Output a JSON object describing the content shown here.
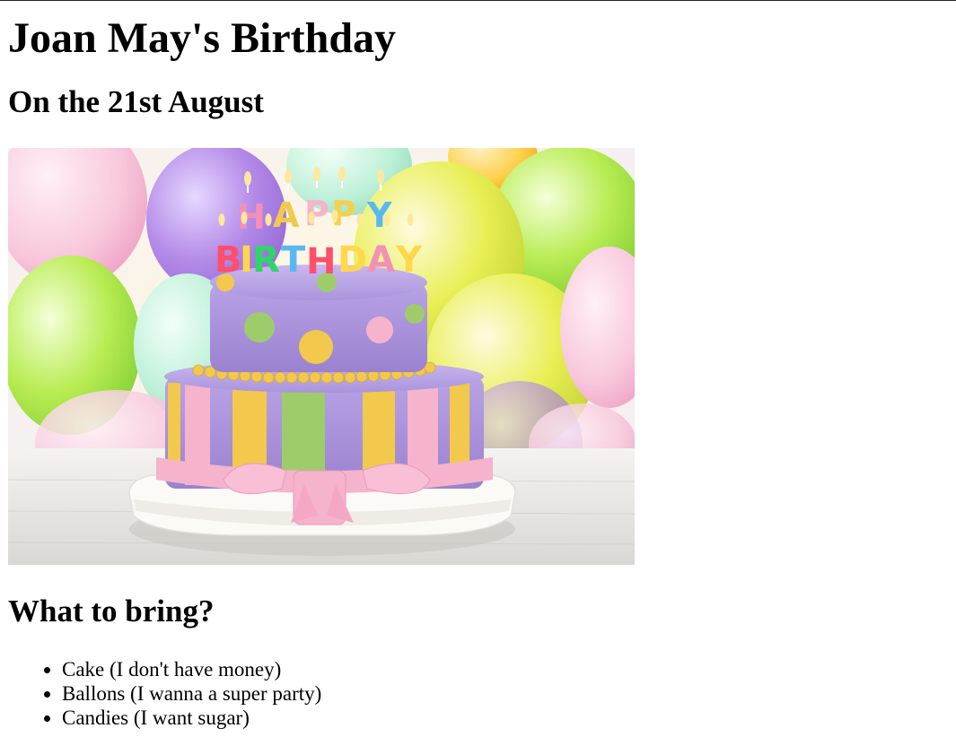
{
  "page": {
    "title": "Joan May's Birthday",
    "subtitle": "On the 21st August",
    "section_title": "What to bring?",
    "items": [
      "Cake (I don't have money)",
      "Ballons (I wanna a super party)",
      "Candies (I want sugar)"
    ]
  },
  "image": {
    "depicts": "birthday-cake",
    "candle_text_top": "HAPPY",
    "candle_text_bottom": "BIRTHDAY"
  },
  "colors": {
    "text": "#000000",
    "background": "#ffffff",
    "cake_purple": "#a98fd6",
    "ribbon_pink": "#f6b3cc",
    "stripe_yellow": "#f2c94c",
    "stripe_green": "#9fcc6a"
  }
}
